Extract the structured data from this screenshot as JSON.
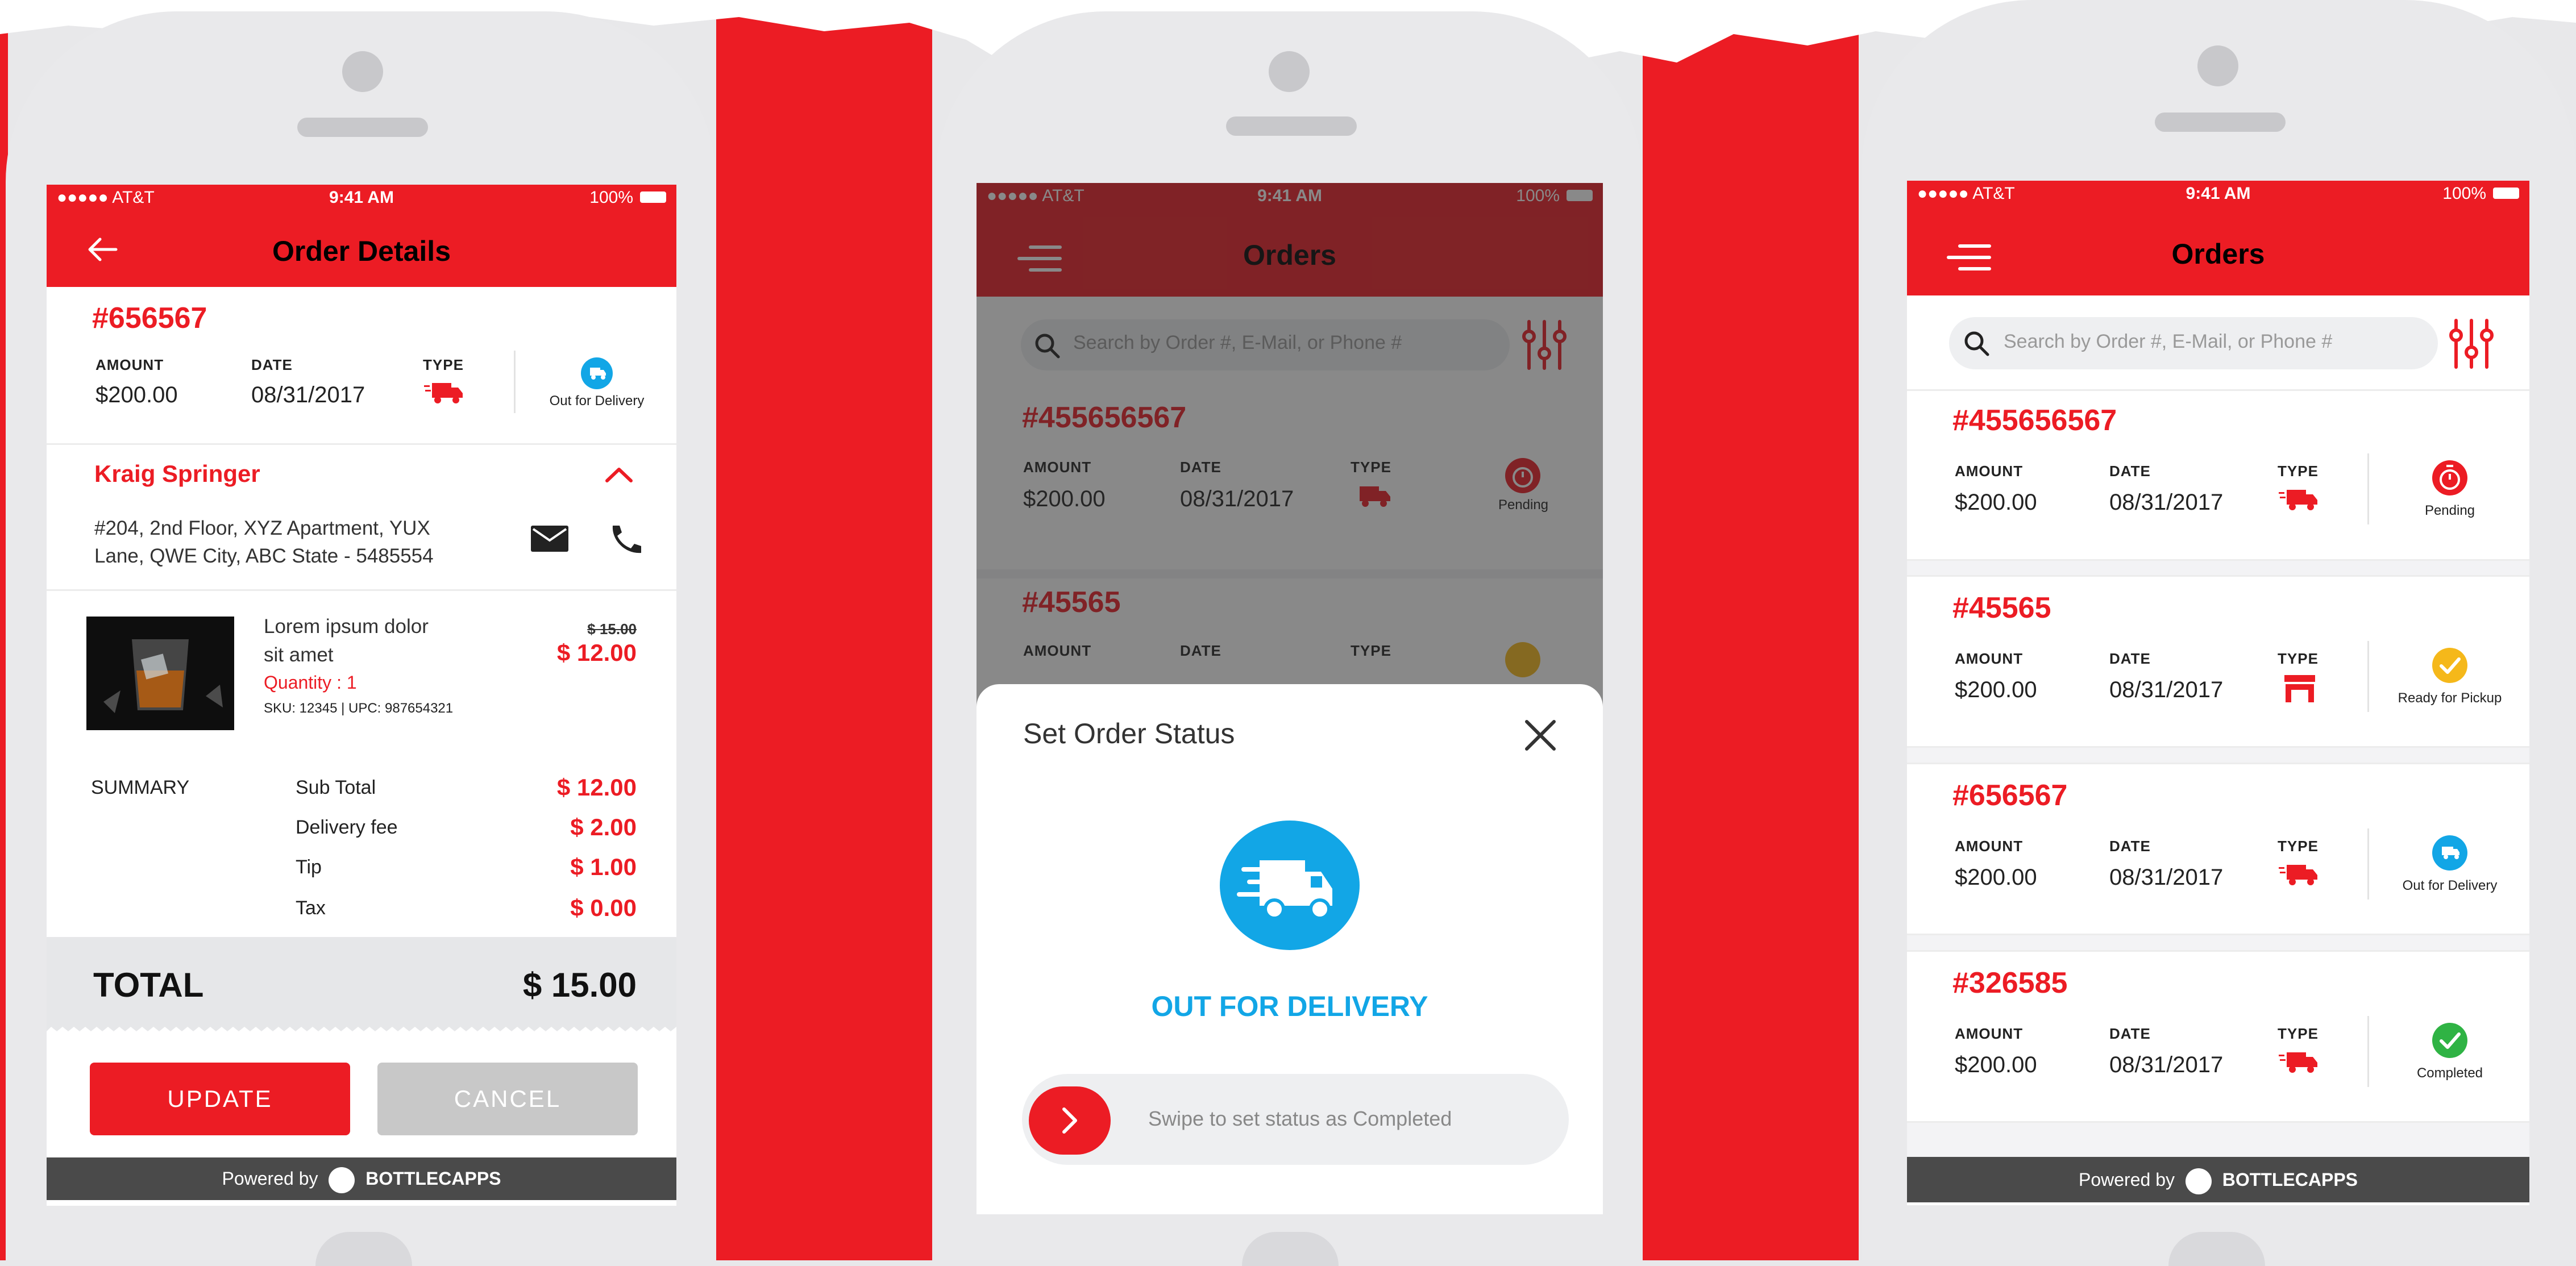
{
  "colors": {
    "accent": "#ec1c24",
    "blue": "#12a6e6",
    "yellow": "#f5b81a",
    "green": "#2fb344",
    "overlay": "#555555"
  },
  "statusbar": {
    "carrier": "●●●●● AT&T",
    "time": "9:41 AM",
    "battery": "100%"
  },
  "order_details": {
    "title": "Order Details",
    "order_no": "#656567",
    "amount_label": "AMOUNT",
    "amount": "$200.00",
    "date_label": "DATE",
    "date": "08/31/2017",
    "type_label": "TYPE",
    "status": "Out for Delivery",
    "customer_name": "Kraig Springer",
    "address_line1": "#204, 2nd Floor, XYZ Apartment, YUX",
    "address_line2": "Lane, QWE City, ABC State - 5485554",
    "item_name_1": "Lorem ipsum dolor",
    "item_name_2": "sit amet",
    "item_quantity": "Quantity : 1",
    "item_sku": "SKU: 12345 | UPC: 987654321",
    "item_old_price": "$ 15.00",
    "item_price": "$ 12.00",
    "summary_label": "SUMMARY",
    "summary": [
      {
        "label": "Sub Total",
        "value": "$ 12.00"
      },
      {
        "label": "Delivery fee",
        "value": "$ 2.00"
      },
      {
        "label": "Tip",
        "value": "$ 1.00"
      },
      {
        "label": "Tax",
        "value": "$ 0.00"
      }
    ],
    "total_label": "TOTAL",
    "total_value": "$ 15.00",
    "update_button": "UPDATE",
    "cancel_button": "CANCEL",
    "footer_powered": "Powered by",
    "footer_brand": "BOTTLECAPPS"
  },
  "orders_list": {
    "title": "Orders",
    "search_placeholder": "Search by Order #, E-Mail, or Phone #",
    "amount_label": "AMOUNT",
    "date_label": "DATE",
    "type_label": "TYPE",
    "orders": [
      {
        "order_no": "#455656567",
        "amount": "$200.00",
        "date": "08/31/2017",
        "status": "Pending",
        "status_icon": "timer-icon",
        "type_icon": "truck-icon"
      },
      {
        "order_no": "#45565",
        "amount": "$200.00",
        "date": "08/31/2017",
        "status": "Ready for Pickup",
        "status_icon": "check-icon",
        "type_icon": "store-icon"
      },
      {
        "order_no": "#656567",
        "amount": "$200.00",
        "date": "08/31/2017",
        "status": "Out for Delivery",
        "status_icon": "delivery-icon",
        "type_icon": "truck-icon"
      },
      {
        "order_no": "#326585",
        "amount": "$200.00",
        "date": "08/31/2017",
        "status": "Completed",
        "status_icon": "check-icon",
        "type_icon": "truck-icon"
      }
    ],
    "footer_powered": "Powered by",
    "footer_brand": "BOTTLECAPPS"
  },
  "status_modal": {
    "title": "Set Order Status",
    "status_text": "OUT FOR DELIVERY",
    "swipe_text": "Swipe to set status as Completed"
  }
}
